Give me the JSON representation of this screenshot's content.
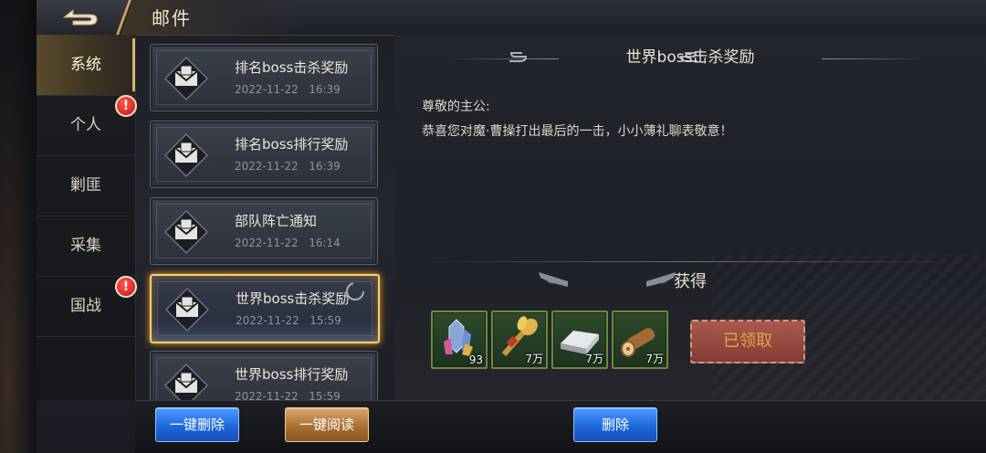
{
  "header": {
    "title": "邮件",
    "back_icon": "back-arrow-icon"
  },
  "tabs": [
    {
      "label": "系统",
      "active": true,
      "alert": false
    },
    {
      "label": "个人",
      "active": false,
      "alert": true
    },
    {
      "label": "剿匪",
      "active": false,
      "alert": false
    },
    {
      "label": "采集",
      "active": false,
      "alert": false
    },
    {
      "label": "国战",
      "active": false,
      "alert": true
    }
  ],
  "alert_mark": "!",
  "mails": [
    {
      "title": "排名boss击杀奖励",
      "date": "2022-11-22",
      "time": "16:39",
      "selected": false
    },
    {
      "title": "排名boss排行奖励",
      "date": "2022-11-22",
      "time": "16:39",
      "selected": false
    },
    {
      "title": "部队阵亡通知",
      "date": "2022-11-22",
      "time": "16:14",
      "selected": false
    },
    {
      "title": "世界boss击杀奖励",
      "date": "2022-11-22",
      "time": "15:59",
      "selected": true
    },
    {
      "title": "世界boss排行奖励",
      "date": "2022-11-22",
      "time": "15:59",
      "selected": false
    }
  ],
  "detail": {
    "title": "世界boss击杀奖励",
    "greeting": "尊敬的主公:",
    "message": "恭喜您对魔·曹操打出最后的一击，小小薄礼聊表敬意！",
    "rewards_header": "获得",
    "rewards": [
      {
        "icon": "crystal-icon",
        "count": "93"
      },
      {
        "icon": "wheat-food-icon",
        "count": "7万"
      },
      {
        "icon": "iron-ingot-icon",
        "count": "7万"
      },
      {
        "icon": "wood-log-icon",
        "count": "7万"
      }
    ],
    "claimed_label": "已领取"
  },
  "footer": {
    "delete_all": "一键删除",
    "read_all": "一键阅读",
    "delete": "删除"
  },
  "colors": {
    "accent_gold": "#ffcf6a",
    "button_blue": "#1e63d8",
    "button_gold": "#a56d2e",
    "claimed_red": "#8e3e34"
  }
}
